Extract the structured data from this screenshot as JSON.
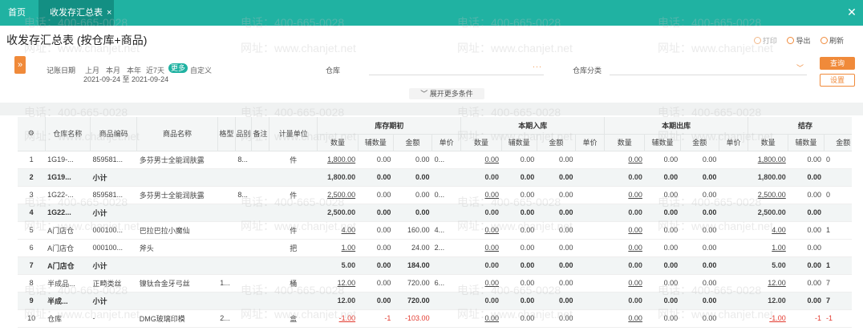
{
  "tabs": {
    "home_label": "首页",
    "active_label": "收发存汇总表",
    "close_glyph": "×",
    "window_close_glyph": "✕"
  },
  "page": {
    "title": "收发存汇总表 (按仓库+商品)",
    "actions": {
      "print": "打印",
      "export": "导出",
      "refresh": "刷新"
    }
  },
  "filter": {
    "expand_glyph": "»",
    "date_label": "记账日期",
    "presets": [
      "上月",
      "本月",
      "本年",
      "近7天",
      "更多",
      "自定义"
    ],
    "active_preset": "更多",
    "date_range": "2021-09-24 至 2021-09-24",
    "warehouse_label": "仓库",
    "warehouse_value": "",
    "warehouse_more": "···",
    "category_label": "仓库分类",
    "category_value": "",
    "category_chevron": "﹀",
    "query_button": "查询",
    "settings_button": "设置",
    "more_conditions": "展开更多条件",
    "more_chevron": "﹀"
  },
  "table": {
    "header_icon": "⚙",
    "columns": [
      "仓库名称",
      "商品编码",
      "商品名称",
      "格型",
      "品别",
      "备注",
      "计量单位"
    ],
    "groups": [
      "库存期初",
      "本期入库",
      "本期出库",
      "结存"
    ],
    "sub_columns": [
      "数量",
      "辅数量",
      "金额",
      "单价"
    ],
    "rows": [
      {
        "no": "1",
        "wh": "1G19-...",
        "code": "859581...",
        "name": "多芬男士全能润肤露",
        "spec": "",
        "cat": "8...",
        "note": "",
        "unit": "件",
        "open_qty": "1,800.00",
        "open_aux": "0.00",
        "open_amt": "0.00",
        "open_price": "0...",
        "in_qty": "0.00",
        "in_aux": "0.00",
        "in_amt": "0.00",
        "in_price": "",
        "out_qty": "0.00",
        "out_aux": "0.00",
        "out_amt": "0.00",
        "out_price": "",
        "bal_qty": "1,800.00",
        "bal_aux": "0.00",
        "bal_amt": "0",
        "subtotal": false
      },
      {
        "no": "2",
        "wh": "1G19...",
        "code": "小计",
        "name": "",
        "spec": "",
        "cat": "",
        "note": "",
        "unit": "",
        "open_qty": "1,800.00",
        "open_aux": "0.00",
        "open_amt": "0.00",
        "open_price": "",
        "in_qty": "0.00",
        "in_aux": "0.00",
        "in_amt": "0.00",
        "in_price": "",
        "out_qty": "0.00",
        "out_aux": "0.00",
        "out_amt": "0.00",
        "out_price": "",
        "bal_qty": "1,800.00",
        "bal_aux": "0.00",
        "bal_amt": "",
        "subtotal": true
      },
      {
        "no": "3",
        "wh": "1G22-...",
        "code": "859581...",
        "name": "多芬男士全能润肤露",
        "spec": "",
        "cat": "8...",
        "note": "",
        "unit": "件",
        "open_qty": "2,500.00",
        "open_aux": "0.00",
        "open_amt": "0.00",
        "open_price": "0...",
        "in_qty": "0.00",
        "in_aux": "0.00",
        "in_amt": "0.00",
        "in_price": "",
        "out_qty": "0.00",
        "out_aux": "0.00",
        "out_amt": "0.00",
        "out_price": "",
        "bal_qty": "2,500.00",
        "bal_aux": "0.00",
        "bal_amt": "0",
        "subtotal": false
      },
      {
        "no": "4",
        "wh": "1G22...",
        "code": "小计",
        "name": "",
        "spec": "",
        "cat": "",
        "note": "",
        "unit": "",
        "open_qty": "2,500.00",
        "open_aux": "0.00",
        "open_amt": "0.00",
        "open_price": "",
        "in_qty": "0.00",
        "in_aux": "0.00",
        "in_amt": "0.00",
        "in_price": "",
        "out_qty": "0.00",
        "out_aux": "0.00",
        "out_amt": "0.00",
        "out_price": "",
        "bal_qty": "2,500.00",
        "bal_aux": "0.00",
        "bal_amt": "",
        "subtotal": true
      },
      {
        "no": "5",
        "wh": "A门店仓",
        "code": "000100...",
        "name": "巴拉巴拉小魔仙",
        "spec": "",
        "cat": "",
        "note": "",
        "unit": "件",
        "open_qty": "4.00",
        "open_aux": "0.00",
        "open_amt": "160.00",
        "open_price": "4...",
        "in_qty": "0.00",
        "in_aux": "0.00",
        "in_amt": "0.00",
        "in_price": "",
        "out_qty": "0.00",
        "out_aux": "0.00",
        "out_amt": "0.00",
        "out_price": "",
        "bal_qty": "4.00",
        "bal_aux": "0.00",
        "bal_amt": "1",
        "subtotal": false
      },
      {
        "no": "6",
        "wh": "A门店仓",
        "code": "000100...",
        "name": "斧头",
        "spec": "",
        "cat": "",
        "note": "",
        "unit": "把",
        "open_qty": "1.00",
        "open_aux": "0.00",
        "open_amt": "24.00",
        "open_price": "2...",
        "in_qty": "0.00",
        "in_aux": "0.00",
        "in_amt": "0.00",
        "in_price": "",
        "out_qty": "0.00",
        "out_aux": "0.00",
        "out_amt": "0.00",
        "out_price": "",
        "bal_qty": "1.00",
        "bal_aux": "0.00",
        "bal_amt": "",
        "subtotal": false
      },
      {
        "no": "7",
        "wh": "A门店仓",
        "code": "小计",
        "name": "",
        "spec": "",
        "cat": "",
        "note": "",
        "unit": "",
        "open_qty": "5.00",
        "open_aux": "0.00",
        "open_amt": "184.00",
        "open_price": "",
        "in_qty": "0.00",
        "in_aux": "0.00",
        "in_amt": "0.00",
        "in_price": "",
        "out_qty": "0.00",
        "out_aux": "0.00",
        "out_amt": "0.00",
        "out_price": "",
        "bal_qty": "5.00",
        "bal_aux": "0.00",
        "bal_amt": "1",
        "subtotal": true
      },
      {
        "no": "8",
        "wh": "半成品...",
        "code": "正畸类丝",
        "name": "镍钛合金牙弓丝",
        "spec": "1...",
        "cat": "",
        "note": "",
        "unit": "桶",
        "open_qty": "12.00",
        "open_aux": "0.00",
        "open_amt": "720.00",
        "open_price": "6...",
        "in_qty": "0.00",
        "in_aux": "0.00",
        "in_amt": "0.00",
        "in_price": "",
        "out_qty": "0.00",
        "out_aux": "0.00",
        "out_amt": "0.00",
        "out_price": "",
        "bal_qty": "12.00",
        "bal_aux": "0.00",
        "bal_amt": "7",
        "subtotal": false
      },
      {
        "no": "9",
        "wh": "半成...",
        "code": "小计",
        "name": "",
        "spec": "",
        "cat": "",
        "note": "",
        "unit": "",
        "open_qty": "12.00",
        "open_aux": "0.00",
        "open_amt": "720.00",
        "open_price": "",
        "in_qty": "0.00",
        "in_aux": "0.00",
        "in_amt": "0.00",
        "in_price": "",
        "out_qty": "0.00",
        "out_aux": "0.00",
        "out_amt": "0.00",
        "out_price": "",
        "bal_qty": "12.00",
        "bal_aux": "0.00",
        "bal_amt": "7",
        "subtotal": true
      },
      {
        "no": "10",
        "wh": "仓库",
        "code": "-",
        "name": "DMG玻璃印模",
        "spec": "2...",
        "cat": "",
        "note": "",
        "unit": "盒",
        "open_qty": "-1.00",
        "open_aux": "-1",
        "open_amt": "-103.00",
        "open_price": "",
        "in_qty": "0.00",
        "in_aux": "0.00",
        "in_amt": "0.00",
        "in_price": "",
        "out_qty": "0.00",
        "out_aux": "0.00",
        "out_amt": "0.00",
        "out_price": "",
        "bal_qty": "-1.00",
        "bal_aux": "-1",
        "bal_amt": "-1",
        "subtotal": false
      }
    ]
  },
  "watermark": {
    "phone": "电话：400-665-0028",
    "site": "网址：www.chanjet.net"
  },
  "colors": {
    "brand_teal": "#20b2a2",
    "tab_active": "#138f83",
    "accent_orange": "#f08a3a",
    "negative_red": "#e23a2f"
  }
}
